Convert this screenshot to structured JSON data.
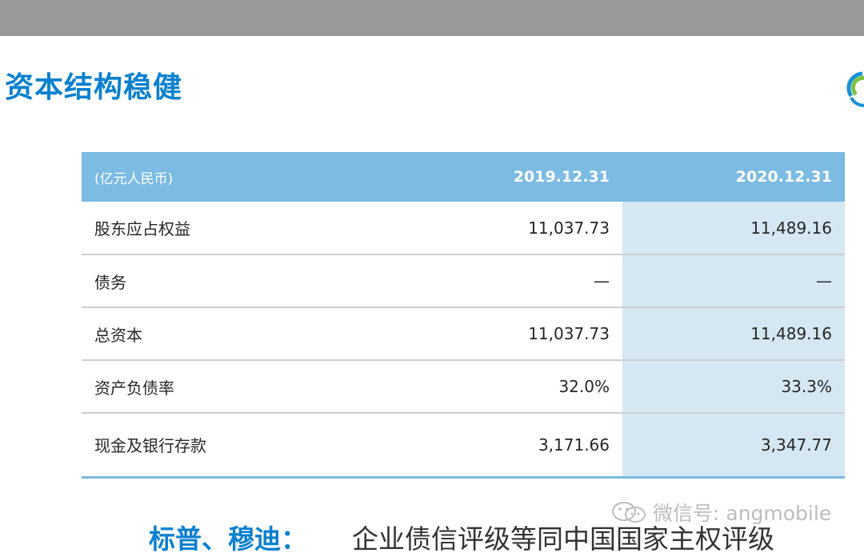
{
  "slide": {
    "title": "资本结构稳健"
  },
  "table": {
    "header": {
      "unit": "(亿元人民币)",
      "col_2019": "2019.12.31",
      "col_2020": "2020.12.31"
    },
    "rows": [
      {
        "label": "股东应占权益",
        "v2019": "11,037.73",
        "v2020": "11,489.16"
      },
      {
        "label": "债务",
        "v2019": "—",
        "v2020": "—"
      },
      {
        "label": "总资本",
        "v2019": "11,037.73",
        "v2020": "11,489.16"
      },
      {
        "label": "资产负债率",
        "v2019": "32.0%",
        "v2020": "33.3%"
      },
      {
        "label": "现金及银行存款",
        "v2019": "3,171.66",
        "v2020": "3,347.77"
      }
    ]
  },
  "footer": {
    "agencies": "标普、穆迪：",
    "rating": "企业债信评级等同中国国家主权评级"
  },
  "watermark": {
    "text": "微信号: angmobile"
  },
  "colors": {
    "accent": "#0a80cf",
    "header_bg": "#7cbbe2",
    "highlight_col": "#d4e7f2",
    "top_bar": "#999999"
  }
}
